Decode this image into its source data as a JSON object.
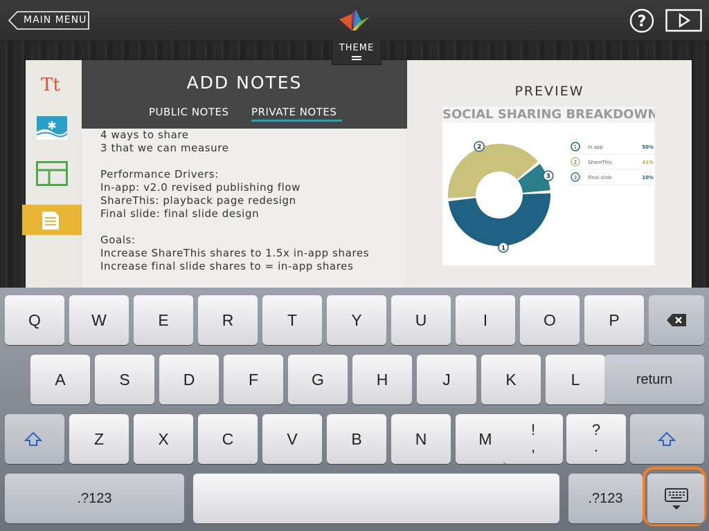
{
  "topbar": {
    "main_menu_label": "MAIN MENU",
    "theme_label": "THEME"
  },
  "notes": {
    "title": "ADD NOTES",
    "tabs": [
      {
        "label": "PUBLIC NOTES",
        "active": false
      },
      {
        "label": "PRIVATE NOTES",
        "active": true
      }
    ],
    "lines": [
      "4 ways to share",
      "3 that we can measure",
      "",
      "Performance Drivers:",
      "In-app: v2.0 revised publishing flow",
      "ShareThis: playback page redesign",
      "Final slide: final slide design",
      "",
      "Goals:",
      "Increase ShareThis shares to 1.5x in-app shares",
      "Increase final slide shares to = in-app shares"
    ]
  },
  "preview": {
    "title": "PREVIEW",
    "slide_title": "SOCIAL SHARING BREAKDOWN"
  },
  "chart_data": {
    "type": "pie",
    "donut": true,
    "categories": [
      "In app",
      "ShareThis",
      "Final slide"
    ],
    "values": [
      50,
      41,
      10
    ],
    "value_labels": [
      "50%",
      "41%",
      "10%"
    ],
    "marker_labels": [
      "1",
      "2",
      "3"
    ],
    "colors": [
      "#1e6182",
      "#c9c27a",
      "#2a7e8c"
    ]
  },
  "colors": {
    "accent_tab": "#1aa4b8",
    "notes_tab": "#e8b534",
    "highlight": "#f57f21"
  },
  "keyboard": {
    "row1": [
      "Q",
      "W",
      "E",
      "R",
      "T",
      "Y",
      "U",
      "I",
      "O",
      "P"
    ],
    "row2": [
      "A",
      "S",
      "D",
      "F",
      "G",
      "H",
      "J",
      "K",
      "L"
    ],
    "row3": [
      "Z",
      "X",
      "C",
      "V",
      "B",
      "N",
      "M"
    ],
    "return_label": "return",
    "numbers_label": ".?123",
    "punct1": [
      "!",
      ","
    ],
    "punct2": [
      "?",
      "."
    ]
  },
  "icons": [
    "back-arrow-icon",
    "logo-icon",
    "help-icon",
    "play-icon",
    "text-icon",
    "image-icon",
    "layout-icon",
    "notes-icon",
    "backspace-icon",
    "shift-icon",
    "hide-keyboard-icon"
  ]
}
